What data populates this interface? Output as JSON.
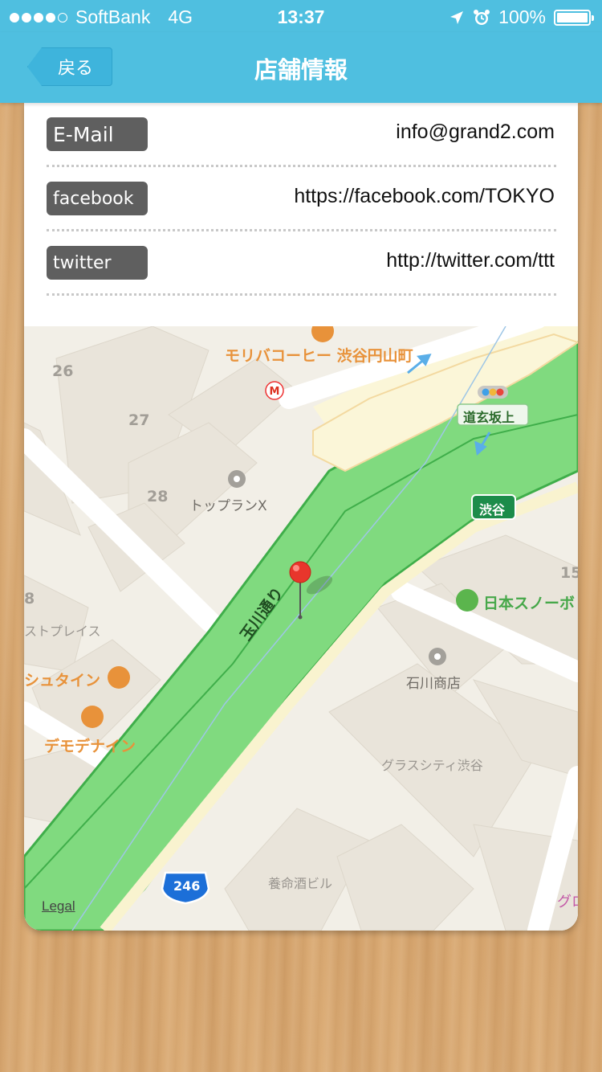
{
  "status_bar": {
    "carrier": "SoftBank",
    "network": "4G",
    "time": "13:37",
    "battery": "100%",
    "battery_fraction": 1.0,
    "signal_bars_filled": 4,
    "signal_bars_total": 5
  },
  "nav": {
    "back_label": "戻る",
    "title": "店舗情報"
  },
  "info": [
    {
      "label": "E-Mail",
      "value": "info@grand2.com"
    },
    {
      "label": "facebook",
      "value": "https://facebook.com/TOKYO"
    },
    {
      "label": "twitter",
      "value": "http://twitter.com/ttt"
    }
  ],
  "map": {
    "road_name": "玉川通り",
    "route_shield": "246",
    "legal": "Legal",
    "pois": {
      "morivacoffee": "モリバコーヒー 渋谷円山町",
      "top_plan": "トップランX",
      "ishikawa": "石川商店",
      "glass_city": "グラスシティ渋谷",
      "youmeishu": "養命酒ビル",
      "nihon_snow": "日本スノーボ",
      "dogenzaka": "道玄坂上",
      "shibuya": "渋谷",
      "shutain": "シュタイン",
      "demodenain": "デモデナイン",
      "stplace": "ストプレイス",
      "gro": "グロ"
    },
    "block_numbers": [
      "26",
      "27",
      "28",
      "8",
      "15"
    ],
    "colors": {
      "road_green": "#80da7f",
      "road_edge": "#3fae4a",
      "land": "#f2efe7",
      "building": "#e8e3d9",
      "pin": "#e8362c",
      "shield": "#1c6fd8"
    }
  }
}
